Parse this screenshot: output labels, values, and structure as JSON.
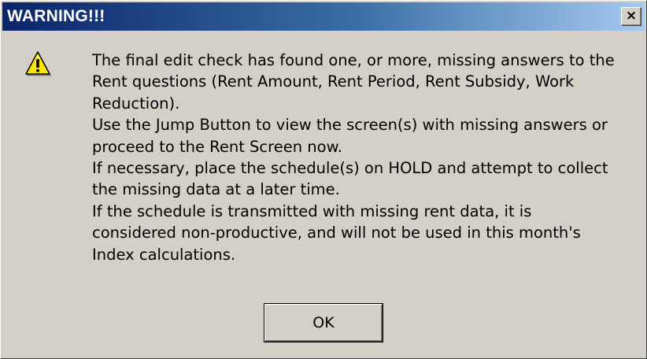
{
  "dialog": {
    "title": "WARNING!!!",
    "close_label": "×",
    "icon": "warning-icon",
    "message_lines": [
      "The final edit check has found one, or more, missing answers to the",
      "Rent questions (Rent Amount, Rent Period, Rent Subsidy, Work",
      "Reduction).",
      "Use the Jump Button to view the screen(s) with missing answers or",
      "proceed to the Rent Screen now.",
      "If necessary,  place the schedule(s) on HOLD and attempt to collect",
      "the missing data at a later time.",
      "If the schedule is transmitted with missing rent data,  it is",
      "considered non-productive, and will not be used in this month's",
      "Index calculations."
    ],
    "ok_label": "OK"
  },
  "colors": {
    "titlebar_start": "#0a246a",
    "titlebar_end": "#a6caf0",
    "face": "#d4d0c8",
    "warning_yellow": "#ffe600"
  }
}
